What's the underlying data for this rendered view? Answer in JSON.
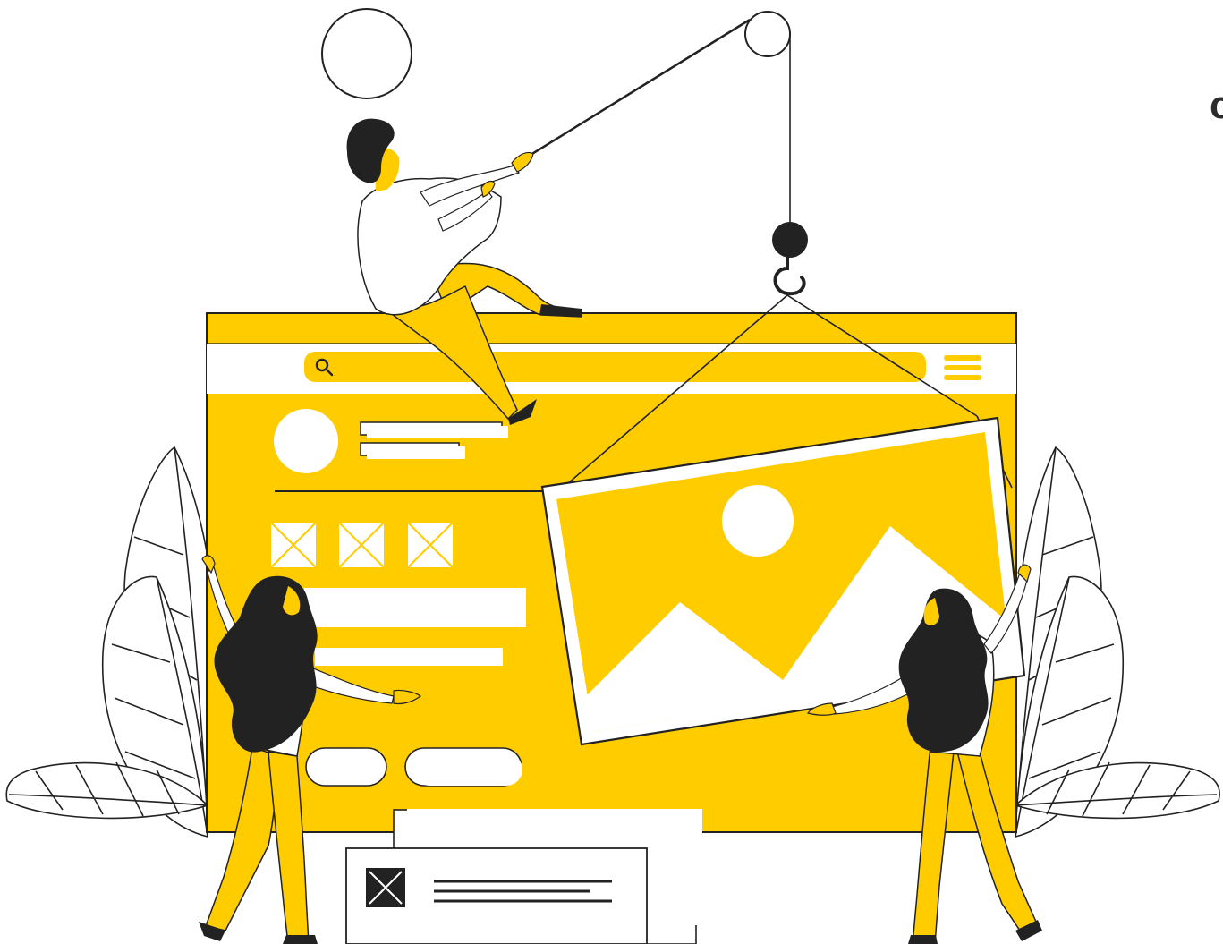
{
  "edge_text": "c",
  "colors": {
    "accent": "#FFCC00",
    "ink": "#222222",
    "paper": "#FFFFFF",
    "hair": "#2B2B2B"
  },
  "icons": {
    "search": "search-icon",
    "menu": "hamburger-menu-icon",
    "image_placeholder": "image-placeholder-icon",
    "broken_image": "x-box-icon"
  }
}
